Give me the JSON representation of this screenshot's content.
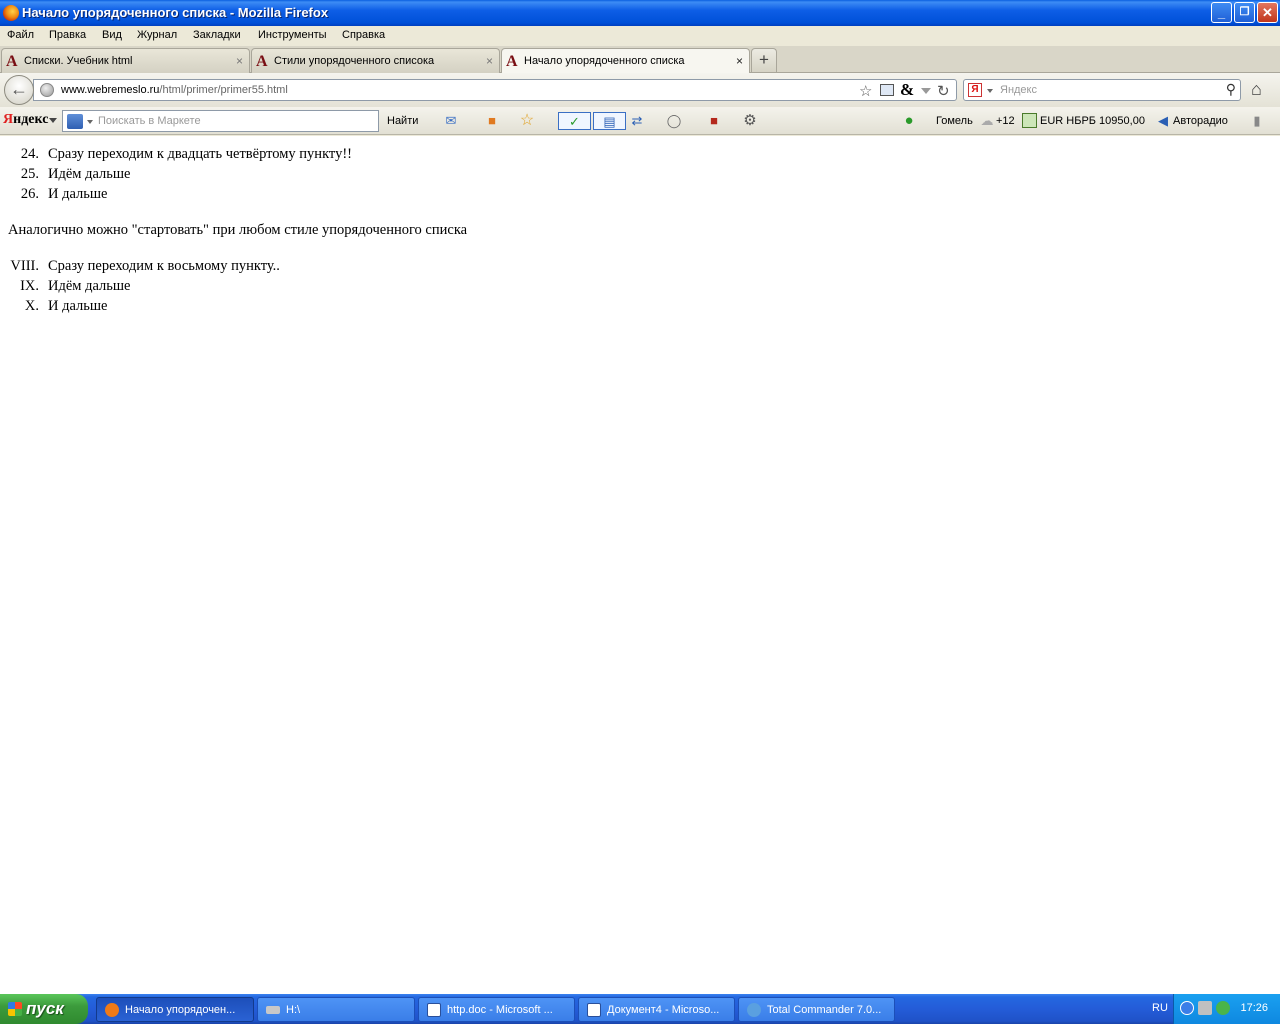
{
  "window": {
    "title": "Начало упорядоченного списка - Mozilla Firefox",
    "btn_min": "_",
    "btn_max": "❐",
    "btn_close": "✕"
  },
  "menu": [
    "Файл",
    "Правка",
    "Вид",
    "Журнал",
    "Закладки",
    "Инструменты",
    "Справка"
  ],
  "tabs": [
    {
      "label": "Списки. Учебник html",
      "active": false
    },
    {
      "label": "Стили упорядоченного списока",
      "active": false
    },
    {
      "label": "Начало упорядоченного списка",
      "active": true
    }
  ],
  "tab_icon": "A",
  "tab_close": "×",
  "new_tab": "+",
  "nav": {
    "back_icon": "←",
    "url_domain": "www.webremeslo.ru",
    "url_path": "/html/primer/primer55.html",
    "search_engine_icon": "Я",
    "search_placeholder": "Яндекс",
    "search_icon": "⚲",
    "home_icon": "⌂",
    "star_icon": "☆",
    "amp_icon": "&",
    "reload_icon": "↻"
  },
  "yandex_bar": {
    "logo_first": "Я",
    "logo_rest": "ндекс",
    "search_placeholder": "Поискать в Маркете",
    "find_label": "Найти",
    "city": "Гомель",
    "weather": "+12",
    "currency": "EUR НБРБ 10950,00",
    "radio": "Авторадио"
  },
  "content": {
    "list1": [
      {
        "num": "24.",
        "text": "Сразу переходим к двадцать четвёртому пункту!!"
      },
      {
        "num": "25.",
        "text": "Идём дальше"
      },
      {
        "num": "26.",
        "text": "И дальше"
      }
    ],
    "paragraph": "Аналогично можно \"стартовать\" при любом стиле упорядоченного списка",
    "list2": [
      {
        "num": "VIII.",
        "text": "Сразу переходим к восьмому пункту.."
      },
      {
        "num": "IX.",
        "text": "Идём дальше"
      },
      {
        "num": "X.",
        "text": "И дальше"
      }
    ]
  },
  "taskbar": {
    "start_label": "пуск",
    "tasks": [
      {
        "label": "Начало упорядочен...",
        "active": true,
        "icon_color": "#f07a18"
      },
      {
        "label": "H:\\",
        "active": false,
        "icon_color": "#c8c8c8"
      },
      {
        "label": "http.doc - Microsoft ...",
        "active": false,
        "icon_color": "#ffffff"
      },
      {
        "label": "Документ4 - Microso...",
        "active": false,
        "icon_color": "#ffffff"
      },
      {
        "label": "Total Commander 7.0...",
        "active": false,
        "icon_color": "#5aa0e0"
      }
    ],
    "lang": "RU",
    "clock": "17:26"
  }
}
